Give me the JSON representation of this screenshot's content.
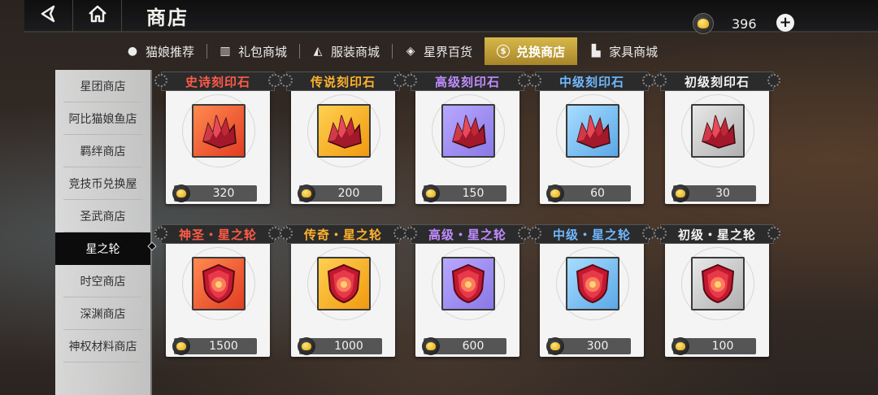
{
  "header": {
    "title": "商店",
    "currency_value": "396",
    "plus_label": "+"
  },
  "tabs": [
    {
      "label": "猫娘推荐",
      "icon": "cat-paw-icon",
      "active": false
    },
    {
      "label": "礼包商城",
      "icon": "gift-icon",
      "active": false
    },
    {
      "label": "服装商城",
      "icon": "clothing-icon",
      "active": false
    },
    {
      "label": "星界百货",
      "icon": "star-drop-icon",
      "active": false
    },
    {
      "label": "兑换商店",
      "icon": "exchange-coin-icon",
      "active": true
    },
    {
      "label": "家具商城",
      "icon": "furniture-icon",
      "active": false
    }
  ],
  "sidebar": {
    "items": [
      {
        "label": "星团商店",
        "active": false
      },
      {
        "label": "阿比猫娘鱼店",
        "active": false
      },
      {
        "label": "羁绊商店",
        "active": false
      },
      {
        "label": "竞技币兑换屋",
        "active": false
      },
      {
        "label": "圣武商店",
        "active": false
      },
      {
        "label": "星之轮",
        "active": true
      },
      {
        "label": "时空商店",
        "active": false
      },
      {
        "label": "深渊商店",
        "active": false
      },
      {
        "label": "神权材料商店",
        "active": false
      }
    ]
  },
  "items": [
    {
      "name": "史诗刻印石",
      "price": "320",
      "rarity": "red",
      "kind": "crystal"
    },
    {
      "name": "传说刻印石",
      "price": "200",
      "rarity": "gold",
      "kind": "crystal"
    },
    {
      "name": "高级刻印石",
      "price": "150",
      "rarity": "purple",
      "kind": "crystal"
    },
    {
      "name": "中级刻印石",
      "price": "60",
      "rarity": "blue",
      "kind": "crystal"
    },
    {
      "name": "初级刻印石",
      "price": "30",
      "rarity": "white",
      "kind": "crystal"
    },
    {
      "name": "神圣・星之轮",
      "price": "1500",
      "rarity": "red",
      "kind": "shield"
    },
    {
      "name": "传奇・星之轮",
      "price": "1000",
      "rarity": "gold",
      "kind": "shield"
    },
    {
      "name": "高级・星之轮",
      "price": "600",
      "rarity": "purple",
      "kind": "shield"
    },
    {
      "name": "中级・星之轮",
      "price": "300",
      "rarity": "blue",
      "kind": "shield"
    },
    {
      "name": "初级・星之轮",
      "price": "100",
      "rarity": "white",
      "kind": "shield"
    }
  ],
  "colors": {
    "red": "#ff5a48",
    "gold": "#ffb22e",
    "purple": "#c08cff",
    "blue": "#6fb8ff",
    "white": "#f2f2f2",
    "active_tab": "#c9a83c"
  }
}
